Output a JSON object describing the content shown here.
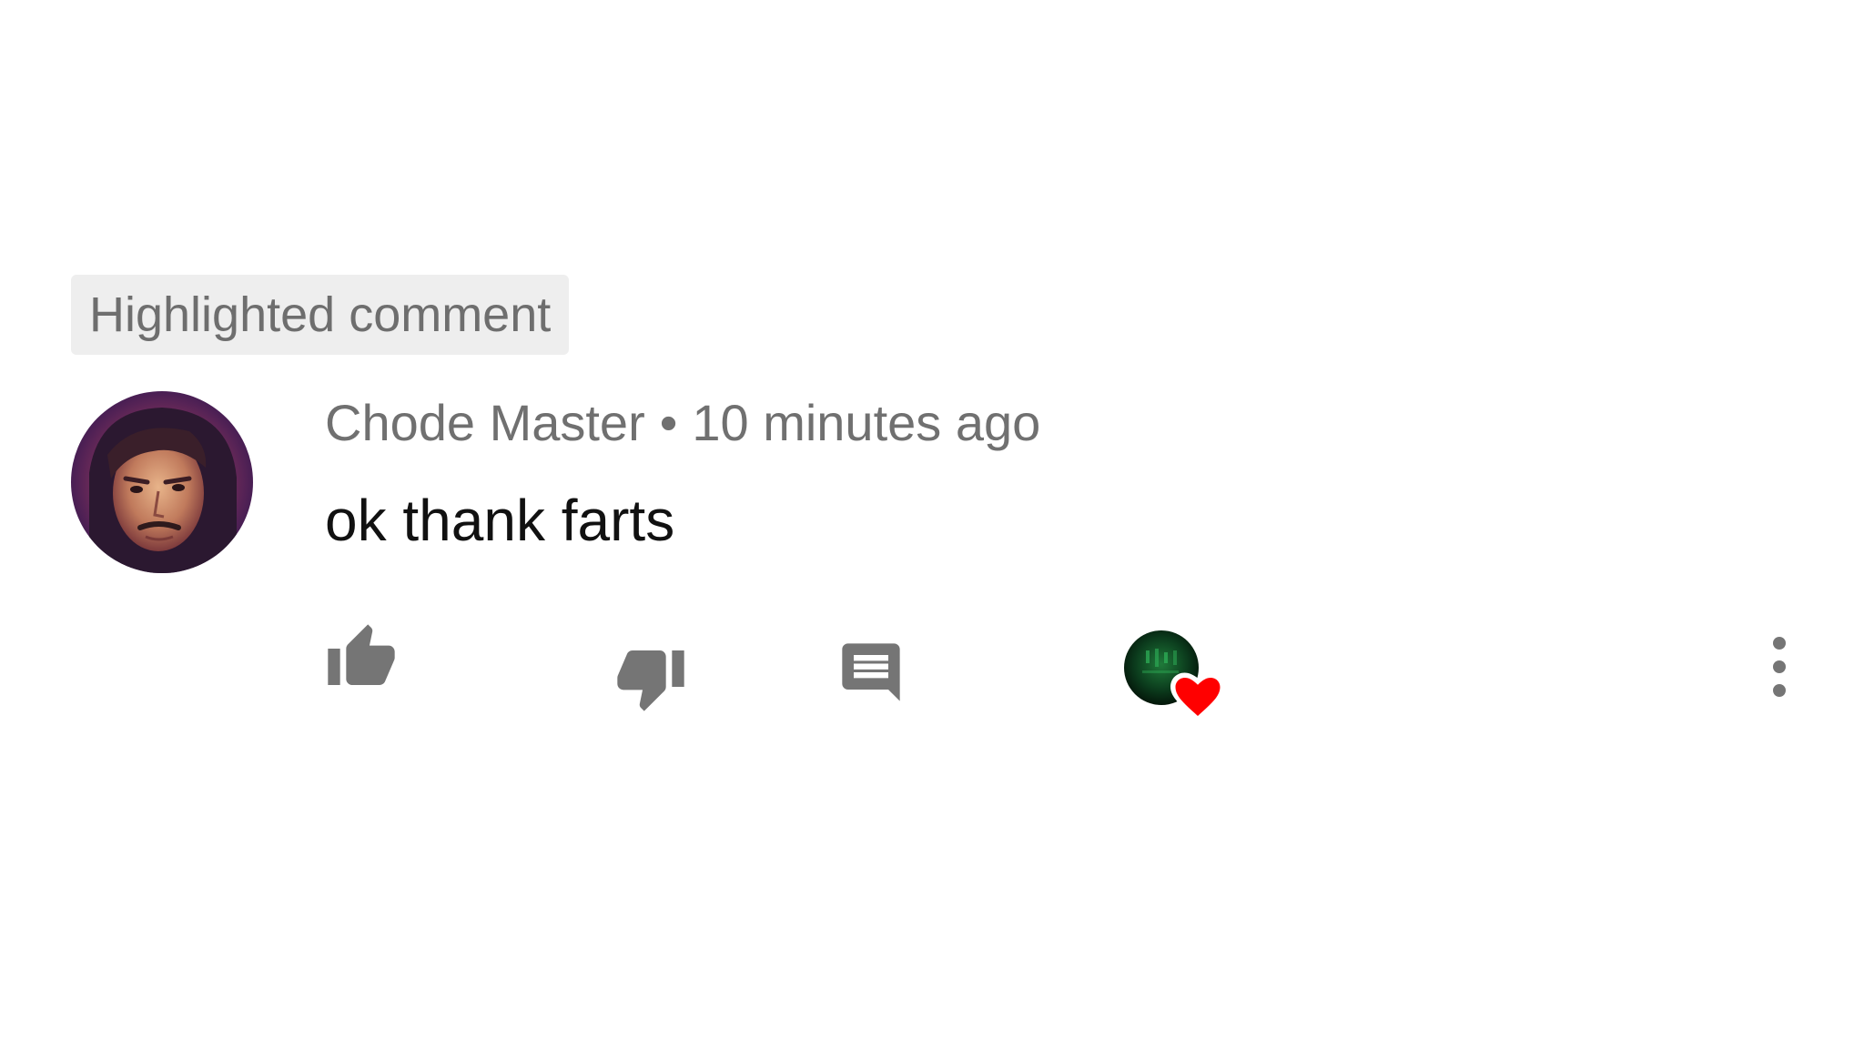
{
  "badge": {
    "label": "Highlighted comment"
  },
  "comment": {
    "author": "Chode Master",
    "separator": "•",
    "timestamp": "10 minutes ago",
    "text": "ok thank farts"
  },
  "actions": {
    "like_icon": "thumb-up-icon",
    "dislike_icon": "thumb-down-icon",
    "reply_icon": "comment-icon",
    "creator_heart_icon": "heart-icon",
    "more_icon": "more-vert-icon"
  },
  "colors": {
    "icon_gray": "#757575",
    "heart_red": "#ff0000",
    "badge_bg": "#eeeeee"
  }
}
